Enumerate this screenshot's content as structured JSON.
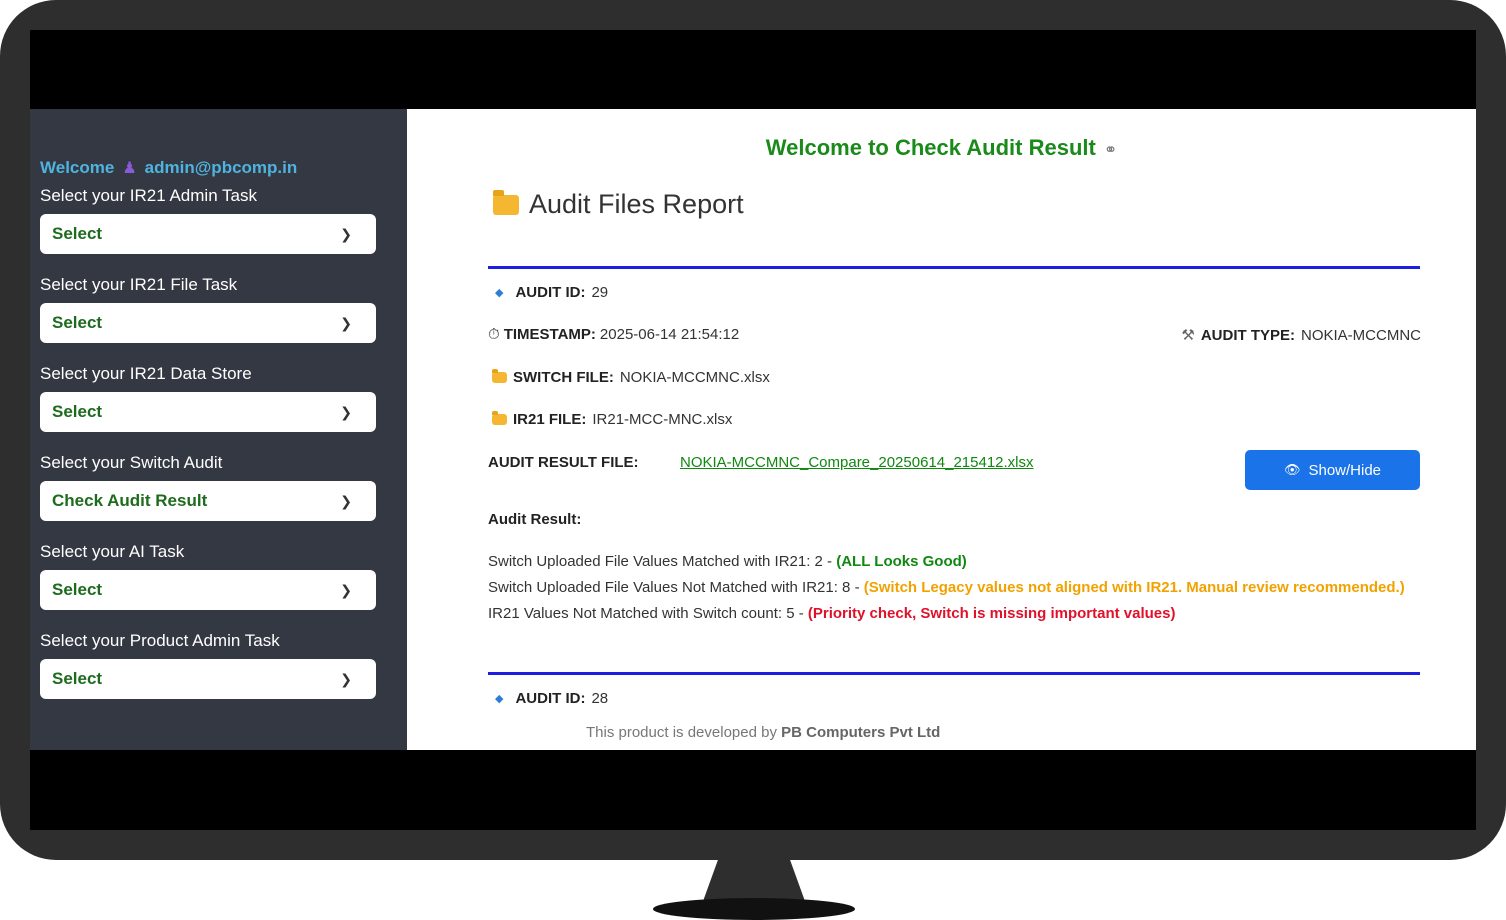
{
  "sidebar": {
    "welcome_label": "Welcome",
    "user_email": "admin@pbcomp.in",
    "tasks": [
      {
        "label": "Select your IR21 Admin Task",
        "value": "Select"
      },
      {
        "label": "Select your IR21 File Task",
        "value": "Select"
      },
      {
        "label": "Select your IR21 Data Store",
        "value": "Select"
      },
      {
        "label": "Select your Switch Audit",
        "value": "Check Audit Result"
      },
      {
        "label": "Select your AI Task",
        "value": "Select"
      },
      {
        "label": "Select your Product Admin Task",
        "value": "Select"
      }
    ]
  },
  "main": {
    "title": "Welcome to Check Audit Result",
    "heading": "Audit Files Report",
    "audits": [
      {
        "id_label": "AUDIT ID:",
        "id": "29",
        "timestamp_label": "TIMESTAMP:",
        "timestamp": "2025-06-14 21:54:12",
        "type_label": "AUDIT TYPE:",
        "type": "NOKIA-MCCMNC",
        "switch_file_label": "SWITCH FILE:",
        "switch_file": "NOKIA-MCCMNC.xlsx",
        "ir21_file_label": "IR21 FILE:",
        "ir21_file": "IR21-MCC-MNC.xlsx",
        "result_file_label": "AUDIT RESULT FILE:",
        "result_file": "NOKIA-MCCMNC_Compare_20250614_215412.xlsx",
        "show_hide_label": "Show/Hide",
        "result_heading": "Audit Result:",
        "results": [
          {
            "text": "Switch Uploaded File Values Matched with IR21: 2 - ",
            "note": "(ALL Looks Good)"
          },
          {
            "text": "Switch Uploaded File Values Not Matched with IR21: 8 - ",
            "note": "(Switch Legacy values not aligned with IR21. Manual review recommended.)"
          },
          {
            "text": "IR21 Values Not Matched with Switch count: 5 - ",
            "note": "(Priority check, Switch is missing important values)"
          }
        ]
      },
      {
        "id_label": "AUDIT ID:",
        "id": "28"
      }
    ],
    "footer_prefix": "This product is developed by ",
    "footer_company": "PB Computers Pvt Ltd"
  }
}
